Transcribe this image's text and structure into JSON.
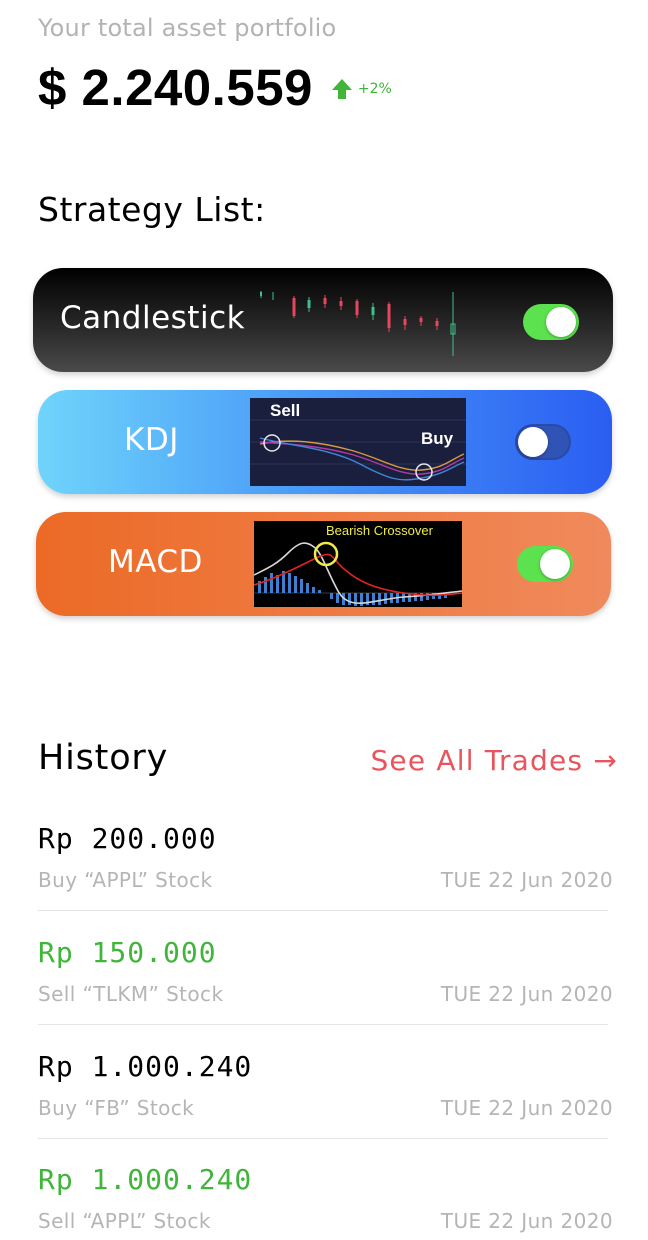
{
  "portfolio": {
    "label": "Your total asset portfolio",
    "value": "$ 2.240.559",
    "change": "+2%",
    "change_icon": "arrow-up-icon",
    "change_color": "#40b53a"
  },
  "strategies": {
    "title": "Strategy List:",
    "items": [
      {
        "label": "Candlestick",
        "enabled": true,
        "thumbnail": "candlestick-chart"
      },
      {
        "label": "KDJ",
        "enabled": false,
        "thumbnail": "kdj-chart",
        "annotations": [
          "Sell",
          "Buy"
        ]
      },
      {
        "label": "MACD",
        "enabled": true,
        "thumbnail": "macd-chart",
        "annotations": [
          "Bearish Crossover"
        ]
      }
    ]
  },
  "history": {
    "title": "History",
    "see_all": "See All Trades →",
    "trades": [
      {
        "amount": "Rp 200.000",
        "description": "Buy “APPL” Stock",
        "date": "TUE 22 Jun 2020",
        "type": "buy"
      },
      {
        "amount": "Rp 150.000",
        "description": "Sell “TLKM” Stock",
        "date": "TUE 22 Jun 2020",
        "type": "sell"
      },
      {
        "amount": "Rp 1.000.240",
        "description": "Buy “FB” Stock",
        "date": "TUE 22 Jun 2020",
        "type": "buy"
      },
      {
        "amount": "Rp 1.000.240",
        "description": "Sell “APPL” Stock",
        "date": "TUE 22 Jun 2020",
        "type": "sell"
      }
    ]
  },
  "colors": {
    "positive": "#3fb53a",
    "link": "#e8555d",
    "toggle_on": "#5be24e"
  }
}
